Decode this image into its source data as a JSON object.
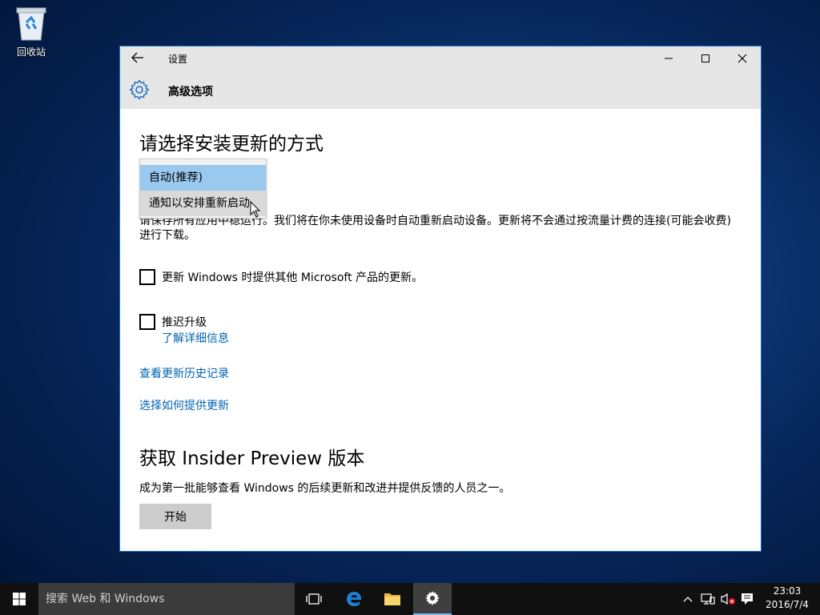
{
  "desktop": {
    "recycle_bin_label": "回收站"
  },
  "window": {
    "title": "设置",
    "page_title": "高级选项",
    "heading": "请选择安装更新的方式",
    "dropdown": {
      "options": [
        "自动(推荐)",
        "通知以安排重新启动"
      ],
      "selected_index": 0,
      "hover_index": 1
    },
    "description_partial": "请保存所有应用中稳运行。我们将在你未使用设备时自动重新启动设备。更新将不会通过按流量计费的连接(可能会收费)进行下载。",
    "checkbox_ms_updates": {
      "label": "更新 Windows 时提供其他 Microsoft 产品的更新。",
      "checked": false
    },
    "checkbox_defer": {
      "label": "推迟升级",
      "checked": false
    },
    "learn_more_link": "了解详细信息",
    "view_history_link": "查看更新历史记录",
    "choose_delivery_link": "选择如何提供更新",
    "insider_heading": "获取 Insider Preview 版本",
    "insider_desc": "成为第一批能够查看 Windows 的后续更新和改进并提供反馈的人员之一。",
    "start_button": "开始"
  },
  "taskbar": {
    "search_placeholder": "搜索 Web 和 Windows",
    "time": "23:03",
    "date": "2016/7/4"
  },
  "colors": {
    "link": "#0063b1",
    "accent": "#1e6fc4",
    "dropdown_selected": "#99c9ef"
  }
}
